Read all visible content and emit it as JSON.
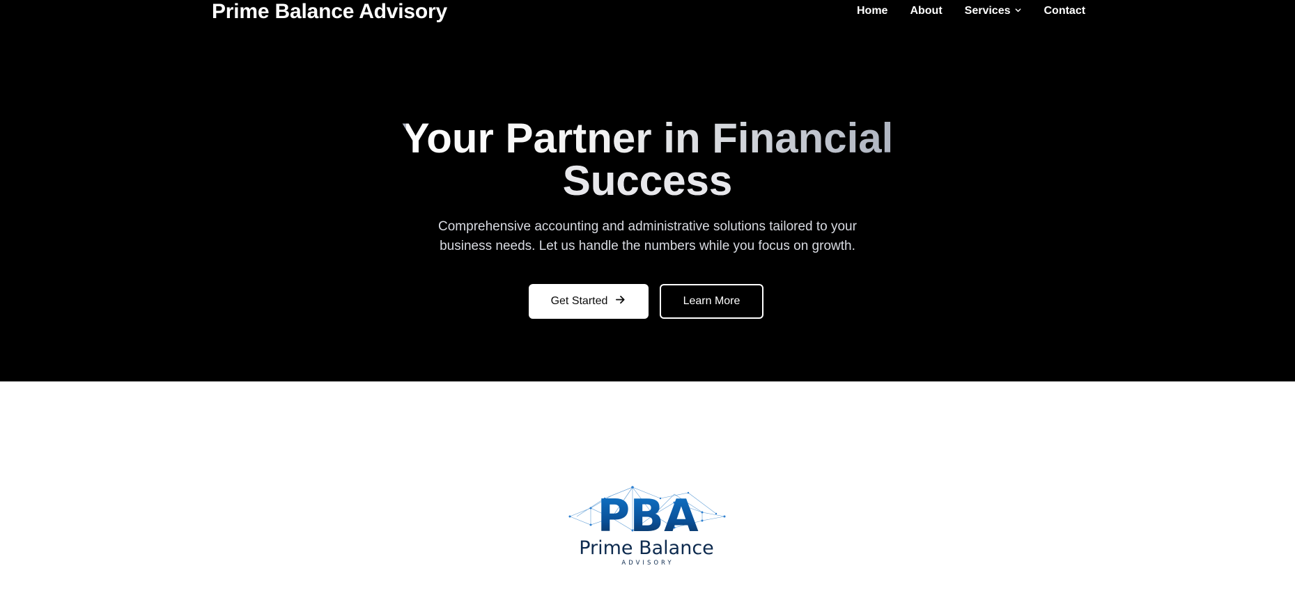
{
  "header": {
    "brand": "Prime Balance Advisory",
    "nav": [
      {
        "label": "Home"
      },
      {
        "label": "About"
      },
      {
        "label": "Services",
        "has_dropdown": true,
        "icon": "chevron-down-icon"
      },
      {
        "label": "Contact"
      }
    ]
  },
  "hero": {
    "title_line1": "Your Partner in Financial",
    "title_line2": "Success",
    "subtitle_line1": "Comprehensive accounting and administrative solutions tailored to your",
    "subtitle_line2": "business needs. Let us handle the numbers while you focus on growth.",
    "primary_button": {
      "label": "Get Started",
      "icon": "arrow-right-icon"
    },
    "secondary_button": {
      "label": "Learn More"
    }
  },
  "logo": {
    "monogram": "PBA",
    "name": "Prime Balance",
    "tagline": "ADVISORY"
  },
  "colors": {
    "hero_bg": "#000000",
    "page_bg": "#ffffff",
    "logo_blue": "#0b5fae",
    "logo_navy": "#0d2a4e"
  }
}
